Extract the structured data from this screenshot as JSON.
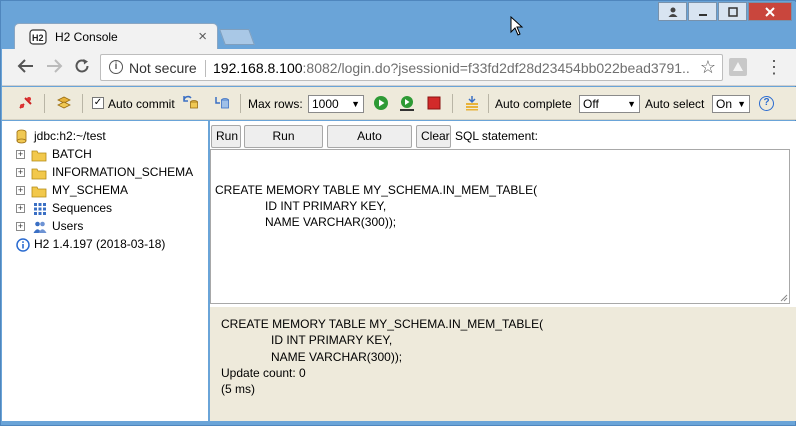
{
  "browser": {
    "tab_title": "H2 Console",
    "tab_close": "×",
    "security_label": "Not secure",
    "url_host": "192.168.8.100",
    "url_rest": ":8082/login.do?jsessionid=f33fd2df28d23454bb022bead3791...",
    "nav_icons": [
      "back-icon",
      "forward-icon",
      "reload-icon"
    ],
    "window_buttons": [
      "user-icon",
      "minimize-icon",
      "maximize-icon",
      "close-icon"
    ]
  },
  "toolbar": {
    "auto_commit_label": "Auto commit",
    "auto_commit_checked": true,
    "max_rows_label": "Max rows:",
    "max_rows_value": "1000",
    "auto_complete_label": "Auto complete",
    "auto_complete_value": "Off",
    "auto_select_label": "Auto select",
    "auto_select_value": "On",
    "help_symbol": "?"
  },
  "tree": {
    "connection": "jdbc:h2:~/test",
    "items": [
      {
        "label": "BATCH",
        "icon": "folder-icon"
      },
      {
        "label": "INFORMATION_SCHEMA",
        "icon": "folder-icon"
      },
      {
        "label": "MY_SCHEMA",
        "icon": "folder-icon"
      },
      {
        "label": "Sequences",
        "icon": "sequences-icon"
      },
      {
        "label": "Users",
        "icon": "users-icon"
      }
    ],
    "version": "H2 1.4.197 (2018-03-18)"
  },
  "editor": {
    "buttons": {
      "run": "Run",
      "run_selected": "Run Selected",
      "auto_complete": "Auto complete",
      "clear": "Clear"
    },
    "sql_label": "SQL statement:",
    "sql_text": "CREATE MEMORY TABLE MY_SCHEMA.IN_MEM_TABLE(\n               ID INT PRIMARY KEY,\n               NAME VARCHAR(300));"
  },
  "result": {
    "text": "CREATE MEMORY TABLE MY_SCHEMA.IN_MEM_TABLE(\n               ID INT PRIMARY KEY,\n               NAME VARCHAR(300));\nUpdate count: 0\n(5 ms)"
  },
  "colors": {
    "frame": "#6aa4d8",
    "toolbar_bg": "#eeeadb",
    "folder": "#f2c84b",
    "run_green": "#2e9a35",
    "stop_red": "#d22a2a"
  }
}
